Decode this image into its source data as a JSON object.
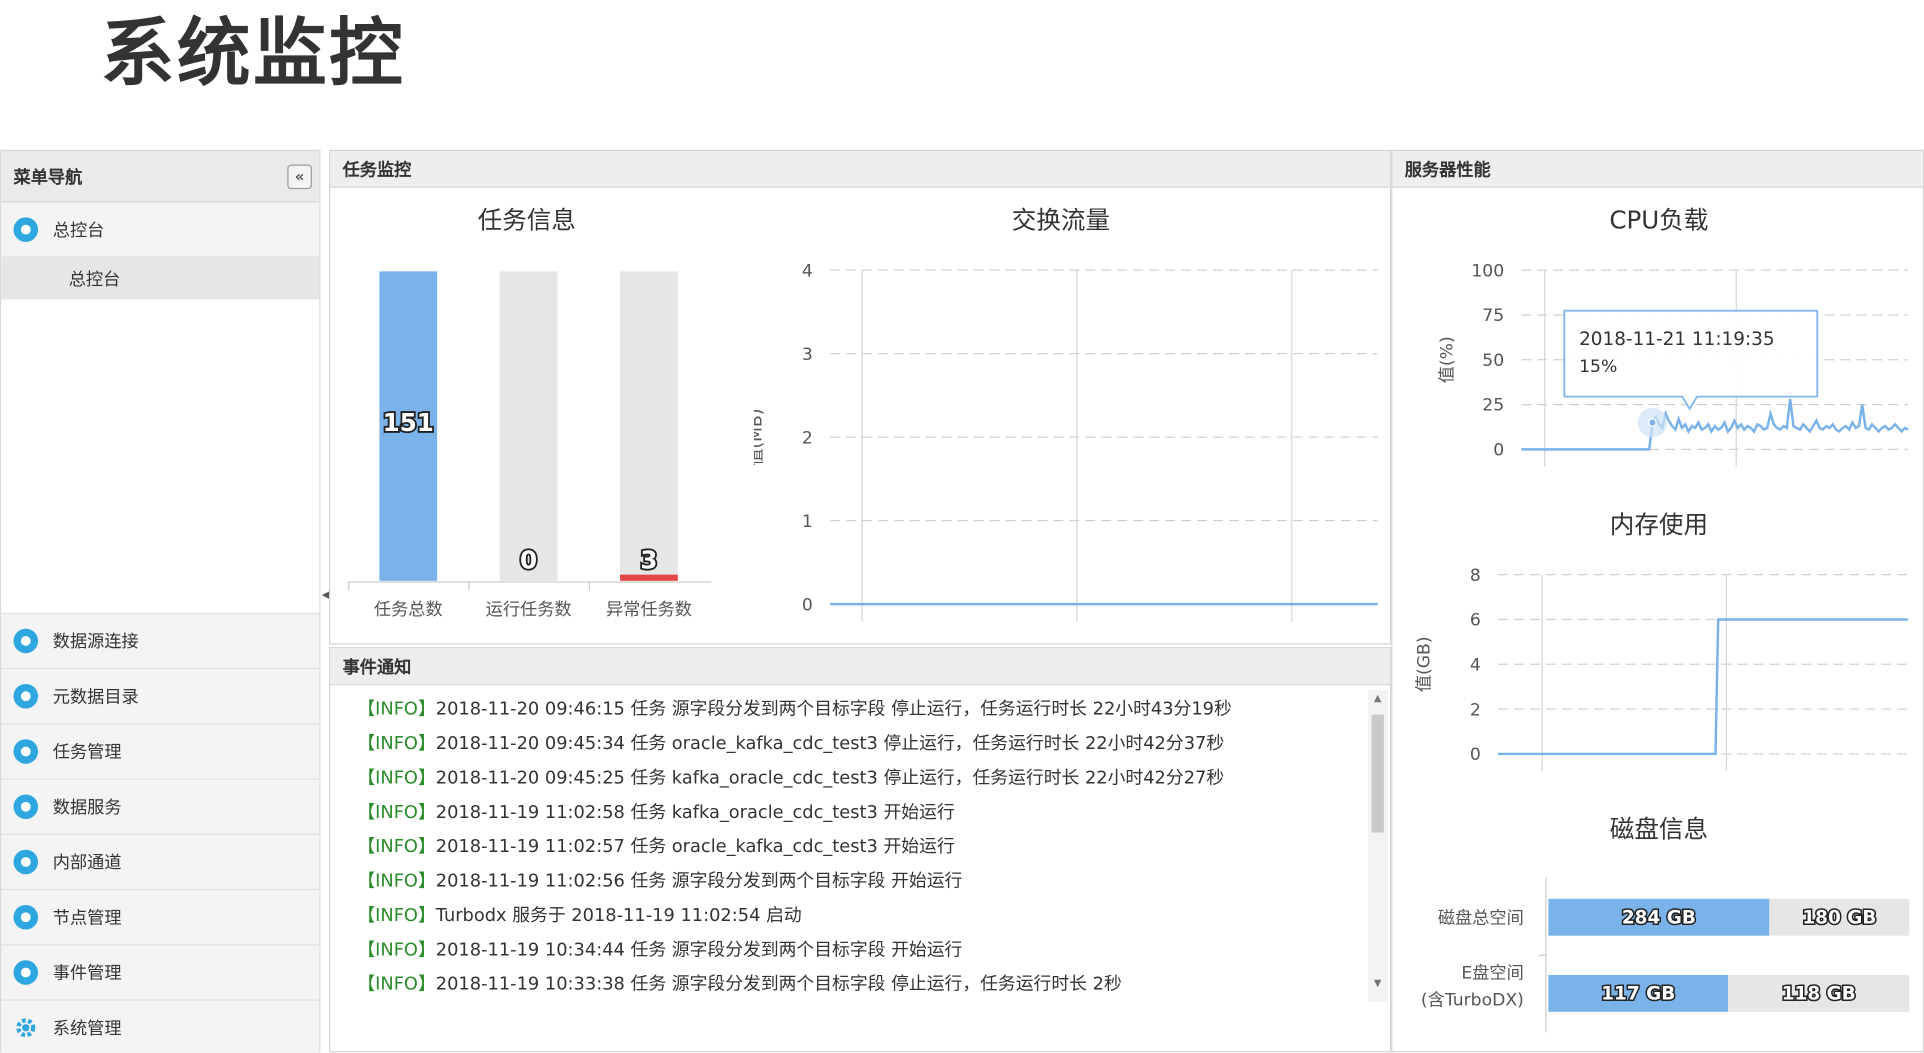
{
  "page_title": "系统监控",
  "sidebar": {
    "title": "菜单导航",
    "collapse_icon": "«",
    "top_item": {
      "label": "总控台",
      "icon": "monitor-icon"
    },
    "sub_item": {
      "label": "总控台"
    },
    "items": [
      {
        "label": "数据源连接",
        "icon": "link-icon"
      },
      {
        "label": "元数据目录",
        "icon": "chart-icon"
      },
      {
        "label": "任务管理",
        "icon": "clock-icon"
      },
      {
        "label": "数据服务",
        "icon": "service-icon"
      },
      {
        "label": "内部通道",
        "icon": "channel-icon"
      },
      {
        "label": "节点管理",
        "icon": "nodes-icon"
      },
      {
        "label": "事件管理",
        "icon": "list-icon"
      },
      {
        "label": "系统管理",
        "icon": "gear-icon"
      }
    ]
  },
  "task_panel": {
    "title": "任务监控",
    "task_info_title": "任务信息",
    "traffic_title": "交换流量"
  },
  "server_panel": {
    "title": "服务器性能",
    "cpu_title": "CPU负载",
    "mem_title": "内存使用",
    "disk_title": "磁盘信息",
    "tooltip": {
      "time": "2018-11-21 11:19:35",
      "value": "15%"
    }
  },
  "event_panel": {
    "title": "事件通知",
    "rows": [
      {
        "tag": "【INFO】",
        "text": "2018-11-20 09:46:15 任务 源字段分发到两个目标字段 停止运行，任务运行时长 22小时43分19秒"
      },
      {
        "tag": "【INFO】",
        "text": "2018-11-20 09:45:34 任务 oracle_kafka_cdc_test3 停止运行，任务运行时长 22小时42分37秒"
      },
      {
        "tag": "【INFO】",
        "text": "2018-11-20 09:45:25 任务 kafka_oracle_cdc_test3 停止运行，任务运行时长 22小时42分27秒"
      },
      {
        "tag": "【INFO】",
        "text": "2018-11-19 11:02:58 任务 kafka_oracle_cdc_test3 开始运行"
      },
      {
        "tag": "【INFO】",
        "text": "2018-11-19 11:02:57 任务 oracle_kafka_cdc_test3 开始运行"
      },
      {
        "tag": "【INFO】",
        "text": "2018-11-19 11:02:56 任务 源字段分发到两个目标字段 开始运行"
      },
      {
        "tag": "【INFO】",
        "text": "Turbodx 服务于 2018-11-19 11:02:54 启动"
      },
      {
        "tag": "【INFO】",
        "text": "2018-11-19 10:34:44 任务 源字段分发到两个目标字段 开始运行"
      },
      {
        "tag": "【INFO】",
        "text": "2018-11-19 10:33:38 任务 源字段分发到两个目标字段 停止运行，任务运行时长 2秒"
      }
    ]
  },
  "colors": {
    "bar_blue": "#7ab3ea",
    "bar_gray": "#e6e6e6",
    "line_blue": "#7ab3ea",
    "error_red": "#e64545",
    "tag_green": "#2a8c2a",
    "accent": "#2ea7e0"
  },
  "chart_data": [
    {
      "type": "bar",
      "title": "任务信息",
      "categories": [
        "任务总数",
        "运行任务数",
        "异常任务数"
      ],
      "values": [
        151,
        0,
        3
      ]
    },
    {
      "type": "line",
      "title": "交换流量",
      "ylabel": "值(MB)",
      "ylim": [
        0,
        4
      ],
      "yticks": [
        0,
        1,
        2,
        3,
        4
      ],
      "grid": true,
      "values": [
        0,
        0,
        0,
        0,
        0,
        0,
        0,
        0,
        0,
        0,
        0,
        0,
        0,
        0,
        0,
        0
      ]
    },
    {
      "type": "line",
      "title": "CPU负载",
      "ylabel": "值(%)",
      "ylim": [
        0,
        100
      ],
      "yticks": [
        0,
        25,
        50,
        75,
        100
      ],
      "grid": true,
      "values": [
        0,
        0,
        0,
        0,
        0,
        0,
        0,
        0,
        0,
        0,
        0,
        0,
        0,
        0,
        0,
        0,
        0,
        0,
        0,
        0,
        0,
        0,
        0,
        0,
        0,
        0,
        0,
        0,
        0,
        0,
        0,
        0,
        0,
        0,
        0,
        0,
        0,
        0,
        0,
        0,
        15,
        18,
        14,
        12,
        20,
        16,
        13,
        11,
        17,
        12,
        14,
        10,
        13,
        12,
        15,
        11,
        12,
        14,
        10,
        13,
        11,
        12,
        15,
        10,
        12,
        16,
        12,
        14,
        11,
        13,
        12,
        10,
        14,
        13,
        11,
        12,
        20,
        14,
        12,
        11,
        13,
        12,
        28,
        13,
        12,
        11,
        14,
        12,
        10,
        13,
        16,
        12,
        11,
        13,
        12,
        14,
        11,
        10,
        12,
        13,
        11,
        15,
        12,
        13,
        25,
        12,
        11,
        14,
        12,
        10,
        12,
        13,
        11,
        12,
        14,
        12,
        10,
        12,
        11
      ]
    },
    {
      "type": "line",
      "title": "内存使用",
      "ylabel": "值(GB)",
      "ylim": [
        0,
        8
      ],
      "yticks": [
        0,
        2,
        4,
        6,
        8
      ],
      "grid": true,
      "values": [
        0,
        0,
        0,
        0,
        0,
        0,
        0,
        0,
        0,
        0,
        0,
        0,
        0,
        0,
        0,
        0,
        0,
        0,
        0,
        0,
        0,
        0,
        0,
        0,
        0,
        0,
        0,
        0,
        0,
        0,
        0,
        0,
        0,
        0,
        0,
        0,
        0,
        0,
        0,
        0,
        0,
        0,
        0,
        0,
        0,
        0,
        0,
        0,
        0,
        0,
        0,
        0,
        0,
        0,
        0,
        0,
        0,
        0,
        0,
        0,
        0,
        0,
        0,
        0,
        0,
        0,
        0,
        0,
        0,
        0,
        0,
        0,
        0,
        0,
        0,
        0,
        0,
        0,
        0,
        0,
        6,
        6,
        6,
        6,
        6,
        6,
        6,
        6,
        6,
        6,
        6,
        6,
        6,
        6,
        6,
        6,
        6,
        6,
        6,
        6,
        6,
        6,
        6,
        6,
        6,
        6,
        6,
        6,
        6,
        6,
        6,
        6,
        6,
        6,
        6,
        6,
        6,
        6,
        6,
        6,
        6,
        6,
        6,
        6,
        6,
        6,
        6,
        6,
        6,
        6,
        6,
        6,
        6,
        6,
        6,
        6,
        6,
        6,
        6,
        6,
        6,
        6,
        6,
        6,
        6,
        6,
        6,
        6,
        6,
        6
      ]
    },
    {
      "type": "bar",
      "title": "磁盘信息",
      "stacked": true,
      "orientation": "horizontal",
      "categories": [
        "磁盘总空间",
        "E盘空间\n(含TurboDX)"
      ],
      "series": [
        {
          "values": [
            284,
            117
          ],
          "labels": [
            "284 GB",
            "117 GB"
          ]
        },
        {
          "values": [
            180,
            118
          ],
          "labels": [
            "180 GB",
            "118 GB"
          ]
        }
      ]
    }
  ]
}
